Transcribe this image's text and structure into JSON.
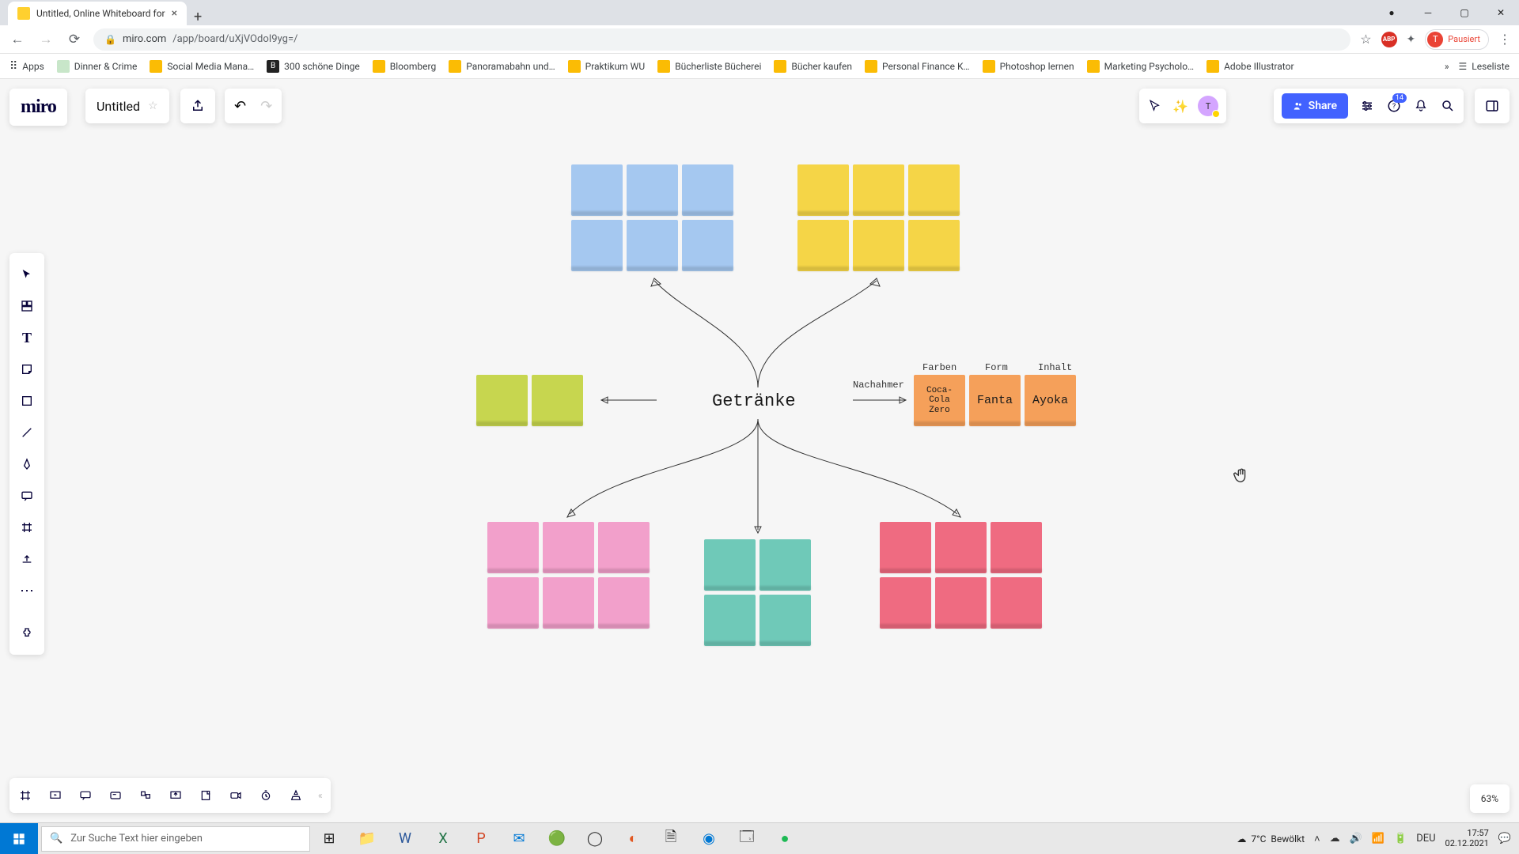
{
  "browser": {
    "tab_title": "Untitled, Online Whiteboard for",
    "url_host": "miro.com",
    "url_path": "/app/board/uXjVOdoI9yg=/",
    "profile_status": "Pausiert",
    "bookmarks": {
      "apps": "Apps",
      "items": [
        "Dinner & Crime",
        "Social Media Mana…",
        "300 schöne Dinge",
        "Bloomberg",
        "Panoramabahn und…",
        "Praktikum WU",
        "Bücherliste Bücherei",
        "Bücher kaufen",
        "Personal Finance K…",
        "Photoshop lernen",
        "Marketing Psycholo…",
        "Adobe Illustrator"
      ],
      "more": "»",
      "readlist": "Leseliste"
    }
  },
  "miro": {
    "board_title": "Untitled",
    "share_label": "Share",
    "help_badge": "14",
    "zoom": "63%"
  },
  "canvas": {
    "center": "Getränke",
    "labels": {
      "left": "Nachahmer",
      "farben": "Farben",
      "form": "Form",
      "inhalt": "Inhalt"
    },
    "orange": {
      "a": "Coca-Cola Zero",
      "b": "Fanta",
      "c": "Ayoka"
    }
  },
  "taskbar": {
    "search_placeholder": "Zur Suche Text hier eingeben",
    "weather_temp": "7°C",
    "weather_desc": "Bewölkt",
    "lang": "DEU",
    "time": "17:57",
    "date": "02.12.2021"
  }
}
